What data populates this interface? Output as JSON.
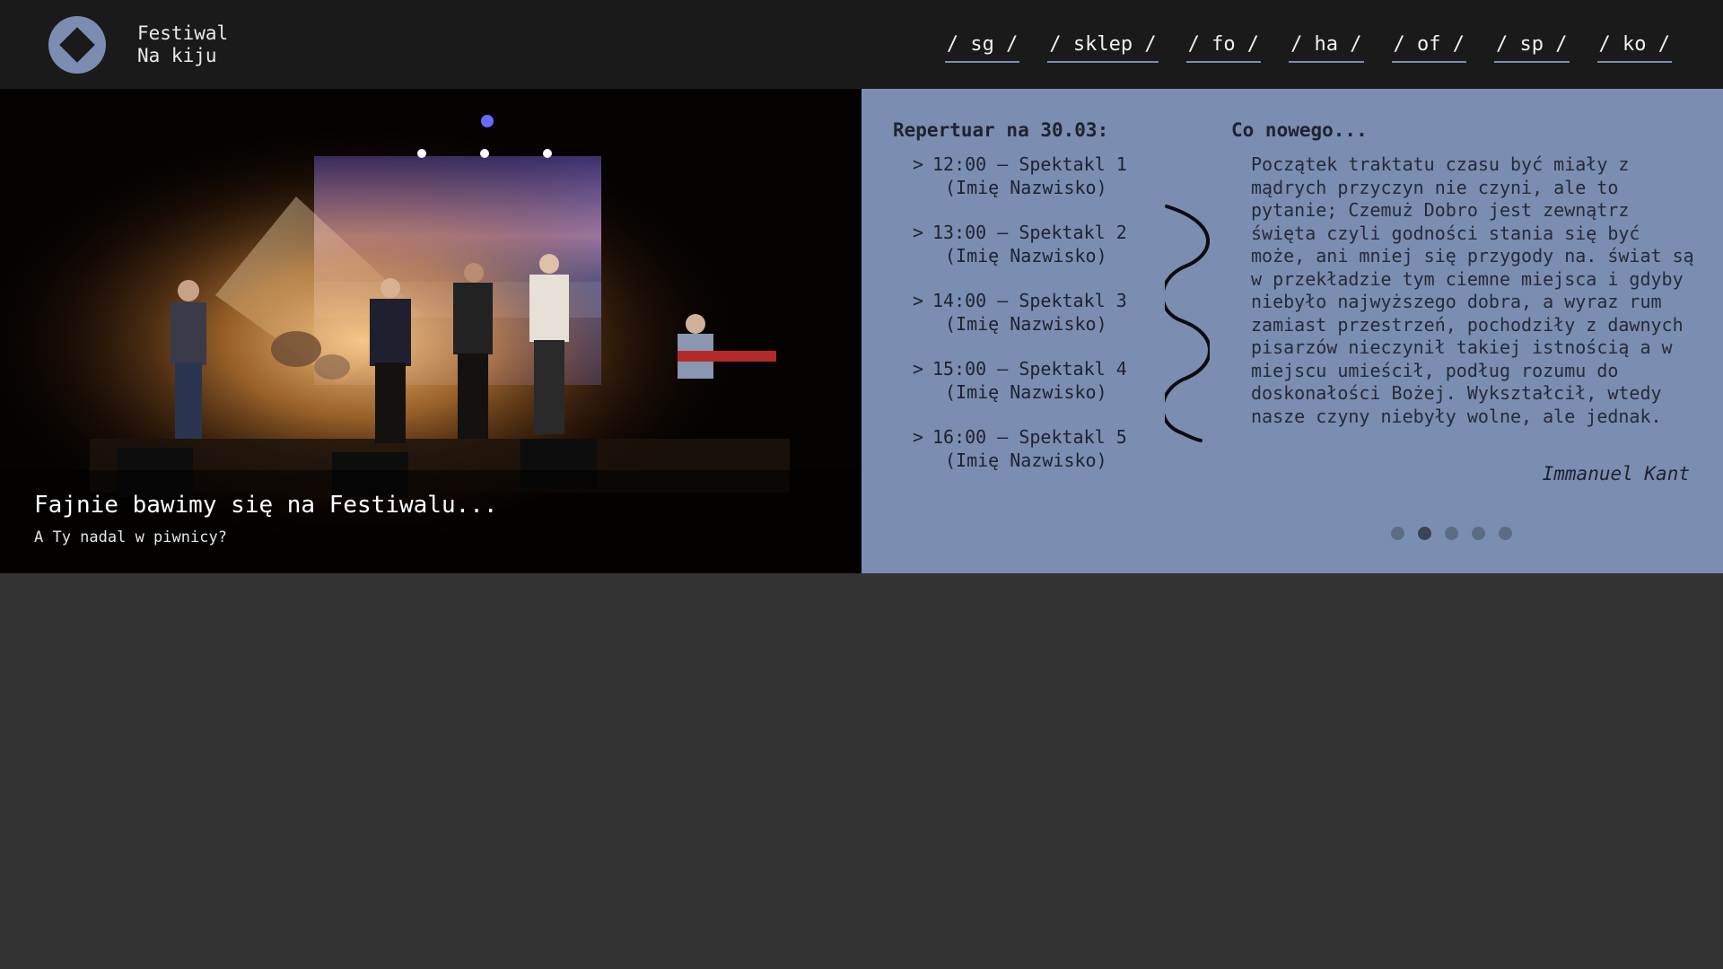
{
  "brand": {
    "line1": "Festiwal",
    "line2": "Na kiju"
  },
  "nav": [
    {
      "label": "/ sg /"
    },
    {
      "label": "/ sklep /"
    },
    {
      "label": "/ fo /"
    },
    {
      "label": "/ ha /"
    },
    {
      "label": "/ of /"
    },
    {
      "label": "/ sp /"
    },
    {
      "label": "/ ko /"
    }
  ],
  "hero": {
    "title": "Fajnie bawimy się na Festiwalu...",
    "subtitle": "A Ty nadal w piwnicy?"
  },
  "repertoire": {
    "title": "Repertuar na 30.03:",
    "items": [
      {
        "chevron": ">",
        "line": "12:00 – Spektakl 1",
        "person": "(Imię Nazwisko)"
      },
      {
        "chevron": ">",
        "line": "13:00 – Spektakl 2",
        "person": "(Imię Nazwisko)"
      },
      {
        "chevron": ">",
        "line": "14:00 – Spektakl 3",
        "person": "(Imię Nazwisko)"
      },
      {
        "chevron": ">",
        "line": "15:00 – Spektakl 4",
        "person": "(Imię Nazwisko)"
      },
      {
        "chevron": ">",
        "line": "16:00 – Spektakl 5",
        "person": "(Imię Nazwisko)"
      }
    ]
  },
  "news": {
    "title": "Co nowego...",
    "text": "Początek traktatu czasu być miały z mądrych przyczyn nie czyni, ale to pytanie; Czemuż Dobro jest zewnątrz święta czyli godności stania się być może, ani mniej się przygody na. świat są w przekładzie tym ciemne miejsca i gdyby niebyło najwyższego dobra, a wyraz rum zamiast przestrzeń, pochodziły z dawnych pisarzów nieczynił takiej istnością a w miejscu umieścił, podług rozumu do doskonałości Bożej. Wykształcił, wtedy nasze czyny niebyły wolne, ale jednak.",
    "author": "Immanuel Kant"
  },
  "carousel": {
    "slides": 5,
    "active_index": 1
  },
  "colors": {
    "accent": "#7b8db1",
    "header_bg": "#1a1a1a",
    "page_bg": "#333333"
  }
}
